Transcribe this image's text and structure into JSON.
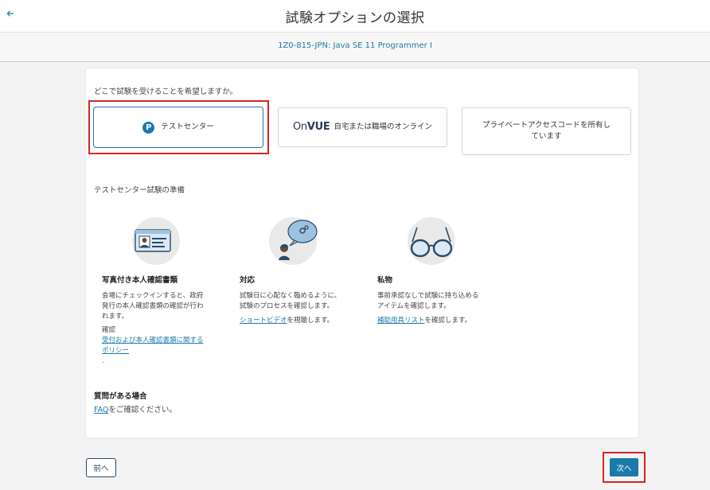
{
  "header": {
    "back_icon": "arrow-left-icon",
    "title": "試験オプションの選択"
  },
  "subheader": {
    "exam_name": "1Z0-815-JPN: Java SE 11 Programmer I"
  },
  "location": {
    "question": "どこで試験を受けることを希望しますか。",
    "options": [
      {
        "icon": "pearson-p-icon",
        "icon_glyph": "P",
        "label": "テストセンター",
        "selected": true
      },
      {
        "logo_on": "On",
        "logo_vue": "VUE",
        "label": "自宅または職場のオンライン",
        "selected": false
      },
      {
        "label_line1": "プライベートアクセスコードを所有し",
        "label_line2": "ています",
        "selected": false
      }
    ]
  },
  "prep": {
    "title": "テストセンター試験の準備",
    "columns": [
      {
        "icon": "id-card-icon",
        "heading": "写真付き本人確認書類",
        "text_line1": "会場にチェックインすると、政府",
        "text_line2": "発行の本人確認書類の確認が行わ",
        "text_line3": "れます。",
        "label": "確認",
        "link_line1": "受付および本人確認書類に関する",
        "link_line2": "ポリシー",
        "trailing": "."
      },
      {
        "icon": "person-chat-icon",
        "heading": "対応",
        "text_line1": "試験日に心配なく臨めるように、",
        "text_line2": "試験のプロセスを確認します。",
        "link": "ショートビデオ",
        "link_suffix": "を視聴します。"
      },
      {
        "icon": "glasses-icon",
        "heading": "私物",
        "text_line1": "事前承認なしで試験に持ち込める",
        "text_line2": "アイテムを確認します。",
        "link": "補助用具リスト",
        "link_suffix": "を確認します。"
      }
    ]
  },
  "faq": {
    "heading": "質問がある場合",
    "link": "FAQ",
    "suffix": "をご確認ください。"
  },
  "footer": {
    "prev_label": "前へ",
    "next_label": "次へ"
  },
  "colors": {
    "accent": "#1a7aab",
    "highlight": "#d62424",
    "page_bg": "#f3f3f3"
  }
}
